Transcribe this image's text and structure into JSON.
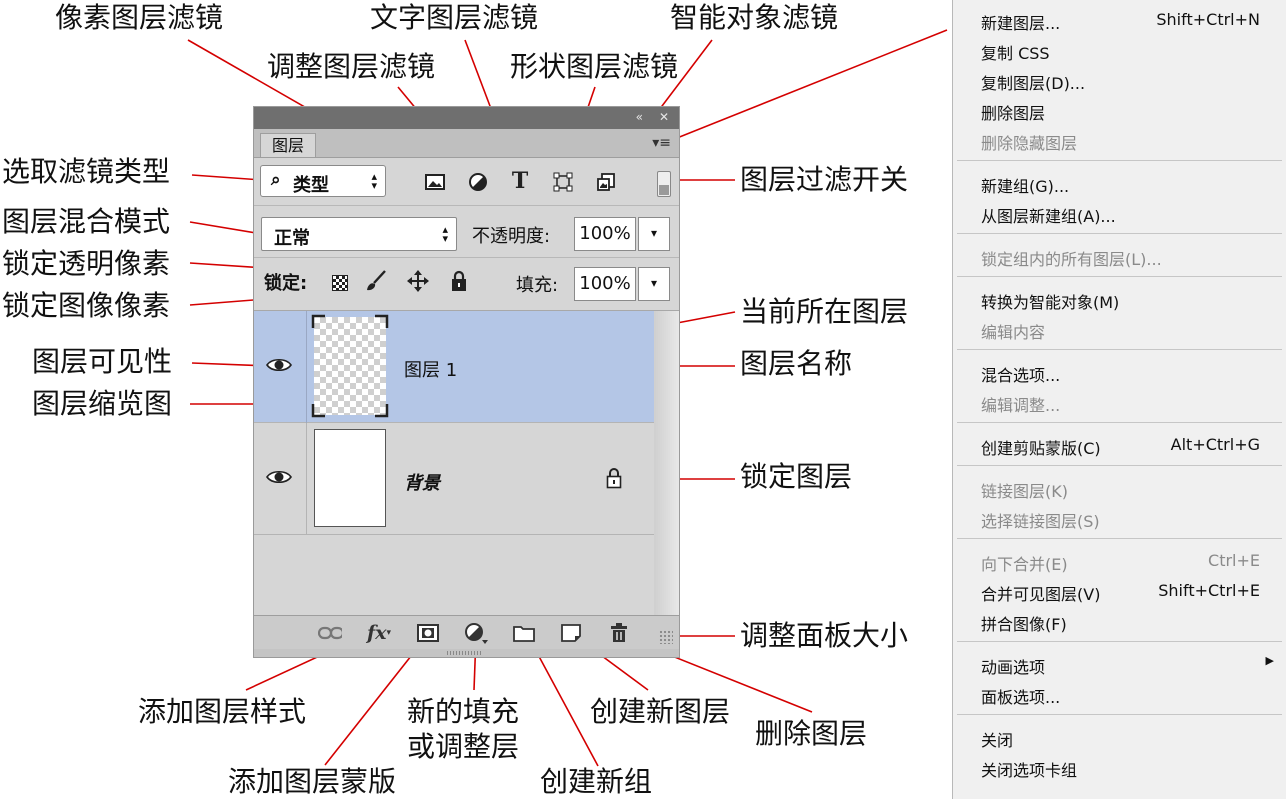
{
  "annotations": {
    "pixel_filter": "像素图层滤镜",
    "text_filter": "文字图层滤镜",
    "smart_filter": "智能对象滤镜",
    "adjust_filter": "调整图层滤镜",
    "shape_filter": "形状图层滤镜",
    "filter_type": "选取滤镜类型",
    "filter_toggle": "图层过滤开关",
    "blend_mode": "图层混合模式",
    "lock_transparent": "锁定透明像素",
    "lock_image": "锁定图像像素",
    "current_layer": "当前所在图层",
    "visibility": "图层可见性",
    "layer_name": "图层名称",
    "thumbnail": "图层缩览图",
    "lock_layer": "锁定图层",
    "resize_panel": "调整面板大小",
    "add_style": "添加图层样式",
    "new_fill": "新的填充",
    "new_fill_2": "或调整层",
    "new_layer": "创建新图层",
    "delete_layer": "删除图层",
    "add_mask": "添加图层蒙版",
    "new_group": "创建新组"
  },
  "panel": {
    "tab": "图层",
    "filter_kind": "类型",
    "blend_mode": "正常",
    "opacity_label": "不透明度:",
    "opacity": "100%",
    "lock_label": "锁定:",
    "fill_label": "填充:",
    "fill": "100%",
    "layers": [
      {
        "name": "图层 1",
        "selected": true,
        "visible": true
      },
      {
        "name": "背景",
        "selected": false,
        "visible": true,
        "locked": true
      }
    ],
    "colors": {
      "selected": "#b4c6e6",
      "panel": "#d6d6d6",
      "annotation_line": "#d40000"
    }
  },
  "context_menu": {
    "items": [
      {
        "label": "新建图层...",
        "shortcut": "Shift+Ctrl+N",
        "disabled": false
      },
      {
        "label": "复制 CSS",
        "shortcut": "",
        "disabled": false
      },
      {
        "label": "复制图层(D)...",
        "shortcut": "",
        "disabled": false
      },
      {
        "label": "删除图层",
        "shortcut": "",
        "disabled": false
      },
      {
        "label": "删除隐藏图层",
        "shortcut": "",
        "disabled": true
      },
      {
        "label": "新建组(G)...",
        "shortcut": "",
        "disabled": false
      },
      {
        "label": "从图层新建组(A)...",
        "shortcut": "",
        "disabled": false
      },
      {
        "label": "锁定组内的所有图层(L)...",
        "shortcut": "",
        "disabled": true
      },
      {
        "label": "转换为智能对象(M)",
        "shortcut": "",
        "disabled": false
      },
      {
        "label": "编辑内容",
        "shortcut": "",
        "disabled": true
      },
      {
        "label": "混合选项...",
        "shortcut": "",
        "disabled": false
      },
      {
        "label": "编辑调整...",
        "shortcut": "",
        "disabled": true
      },
      {
        "label": "创建剪贴蒙版(C)",
        "shortcut": "Alt+Ctrl+G",
        "disabled": false
      },
      {
        "label": "链接图层(K)",
        "shortcut": "",
        "disabled": true
      },
      {
        "label": "选择链接图层(S)",
        "shortcut": "",
        "disabled": true
      },
      {
        "label": "向下合并(E)",
        "shortcut": "Ctrl+E",
        "disabled": true
      },
      {
        "label": "合并可见图层(V)",
        "shortcut": "Shift+Ctrl+E",
        "disabled": false
      },
      {
        "label": "拼合图像(F)",
        "shortcut": "",
        "disabled": false
      },
      {
        "label": "动画选项",
        "shortcut": "",
        "disabled": false,
        "submenu": true
      },
      {
        "label": "面板选项...",
        "shortcut": "",
        "disabled": false
      },
      {
        "label": "关闭",
        "shortcut": "",
        "disabled": false
      },
      {
        "label": "关闭选项卡组",
        "shortcut": "",
        "disabled": false
      }
    ]
  }
}
